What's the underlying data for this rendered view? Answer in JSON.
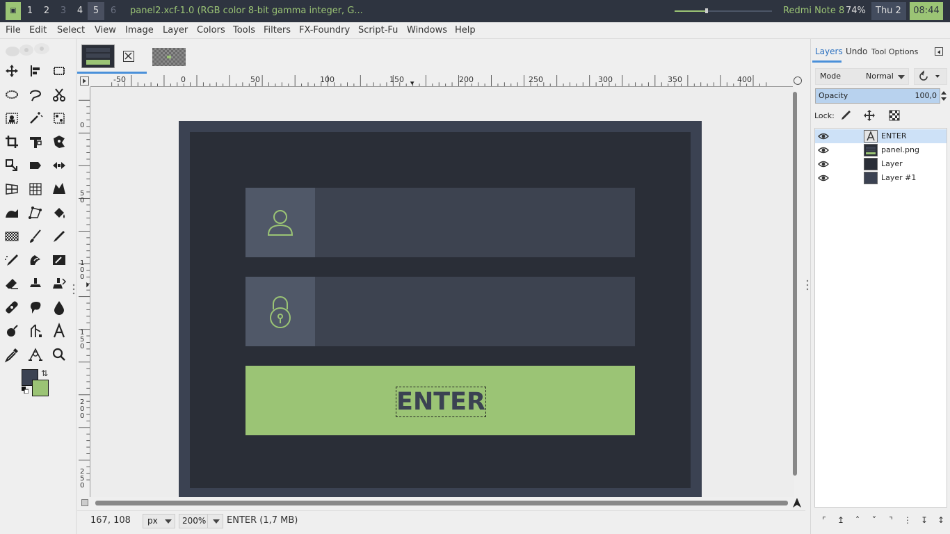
{
  "topbar": {
    "workspaces": [
      "1",
      "2",
      "3",
      "4",
      "5",
      "6"
    ],
    "active_workspace": "5",
    "window_title": "panel2.xcf-1.0 (RGB color 8-bit gamma integer, G...",
    "volume_level": 0.33,
    "device": "Redmi Note 8",
    "battery": "74%",
    "day": "Thu  2",
    "clock": "08:44"
  },
  "menubar": [
    "File",
    "Edit",
    "Select",
    "View",
    "Image",
    "Layer",
    "Colors",
    "Tools",
    "Filters",
    "FX-Foundry",
    "Script-Fu",
    "Windows",
    "Help"
  ],
  "toolbox": {
    "tools": [
      "move",
      "align",
      "rect-select",
      "ellipse-select",
      "free-select",
      "scissors-select",
      "fuzzy-select",
      "wand",
      "by-color-select",
      "crop",
      "transform",
      "warp-transform",
      "flip",
      "unified-transform",
      "handle-transform",
      "perspective",
      "cage",
      "warp",
      "bucket-fill",
      "path",
      "paint-select",
      "gradient",
      "paintbrush",
      "pencil",
      "airbrush",
      "ink",
      "mypaint",
      "eraser",
      "clone",
      "perspective-clone",
      "heal",
      "smudge",
      "dodge",
      "blur",
      "measure",
      "text",
      "color-picker",
      "path-edit",
      "zoom"
    ],
    "fg_color": "#3b4252",
    "bg_color": "#9bc475"
  },
  "ruler": {
    "h_labels": [
      "-50",
      "0",
      "50",
      "100",
      "150",
      "200",
      "250",
      "300",
      "350",
      "400"
    ],
    "v_labels": [
      "0",
      "50",
      "100",
      "150",
      "200",
      "250"
    ]
  },
  "image": {
    "enter_label": "ENTER",
    "colors": {
      "outer": "#3b4252",
      "inner": "#2a2e37",
      "field": "#3d4350",
      "iconbox": "#505868",
      "accent": "#9bc475"
    },
    "field_icons": [
      "user-icon",
      "lock-icon"
    ]
  },
  "statusbar": {
    "coords": "167, 108",
    "unit": "px",
    "zoom": "200%",
    "layer_info": "ENTER (1,7  MB)"
  },
  "dock": {
    "tabs": [
      "Layers",
      "Undo",
      "Tool Options"
    ],
    "mode_label": "Mode",
    "mode_value": "Normal",
    "opacity_label": "Opacity",
    "opacity_value": "100,0",
    "lock_label": "Lock:",
    "layers": [
      {
        "name": "ENTER",
        "selected": true
      },
      {
        "name": "panel.png",
        "selected": false
      },
      {
        "name": "Layer",
        "selected": false
      },
      {
        "name": "Layer #1",
        "selected": false
      }
    ]
  }
}
